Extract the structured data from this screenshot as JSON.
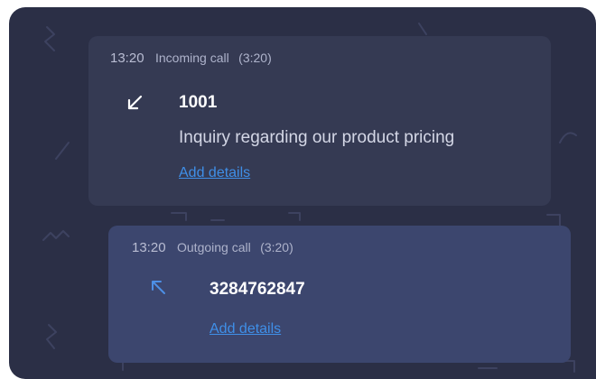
{
  "calls": [
    {
      "time": "13:20",
      "type": "Incoming call",
      "duration": "(3:20)",
      "direction_icon": "arrow-down-left-icon",
      "number": "1001",
      "note": "Inquiry regarding our product pricing",
      "action_label": "Add details"
    },
    {
      "time": "13:20",
      "type": "Outgoing call",
      "duration": "(3:20)",
      "direction_icon": "arrow-up-left-icon",
      "number": "3284762847",
      "action_label": "Add details"
    }
  ],
  "colors": {
    "panel_background": "#2b2f46",
    "incoming_card": "#353a53",
    "outgoing_card": "#3c466e",
    "link": "#3f8fe8",
    "outgoing_arrow": "#4d8fe6"
  }
}
